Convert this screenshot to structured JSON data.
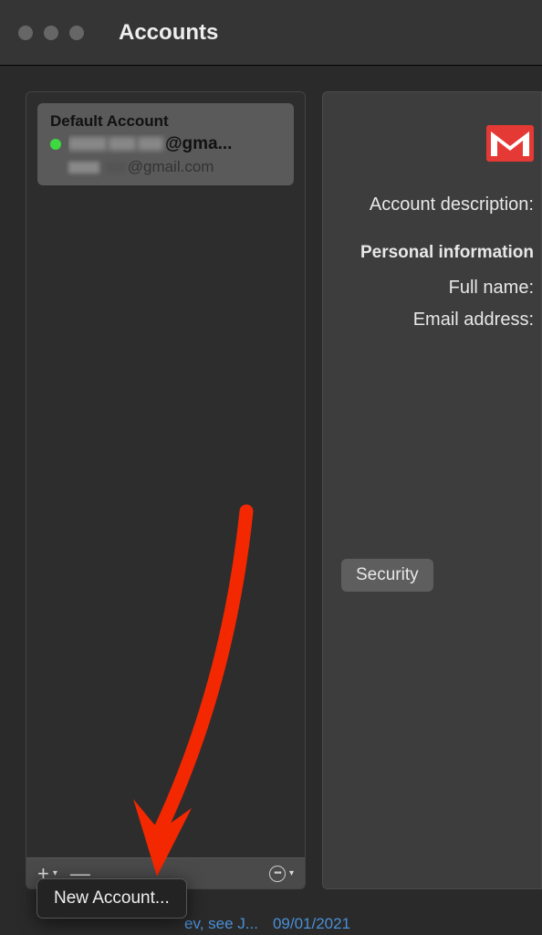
{
  "titlebar": {
    "title": "Accounts"
  },
  "sidebar": {
    "account": {
      "default_label": "Default Account",
      "primary_suffix": "@gma...",
      "secondary_suffix": "@gmail.com"
    },
    "toolbar": {
      "add": "+",
      "remove": "—"
    }
  },
  "detail": {
    "account_description_label": "Account description:",
    "personal_info_header": "Personal information",
    "full_name_label": "Full name:",
    "email_label": "Email address:",
    "security_button": "Security"
  },
  "popup": {
    "new_account": "New Account..."
  },
  "footer": {
    "text1": "ev, see J...",
    "text2": "09/01/2021"
  }
}
